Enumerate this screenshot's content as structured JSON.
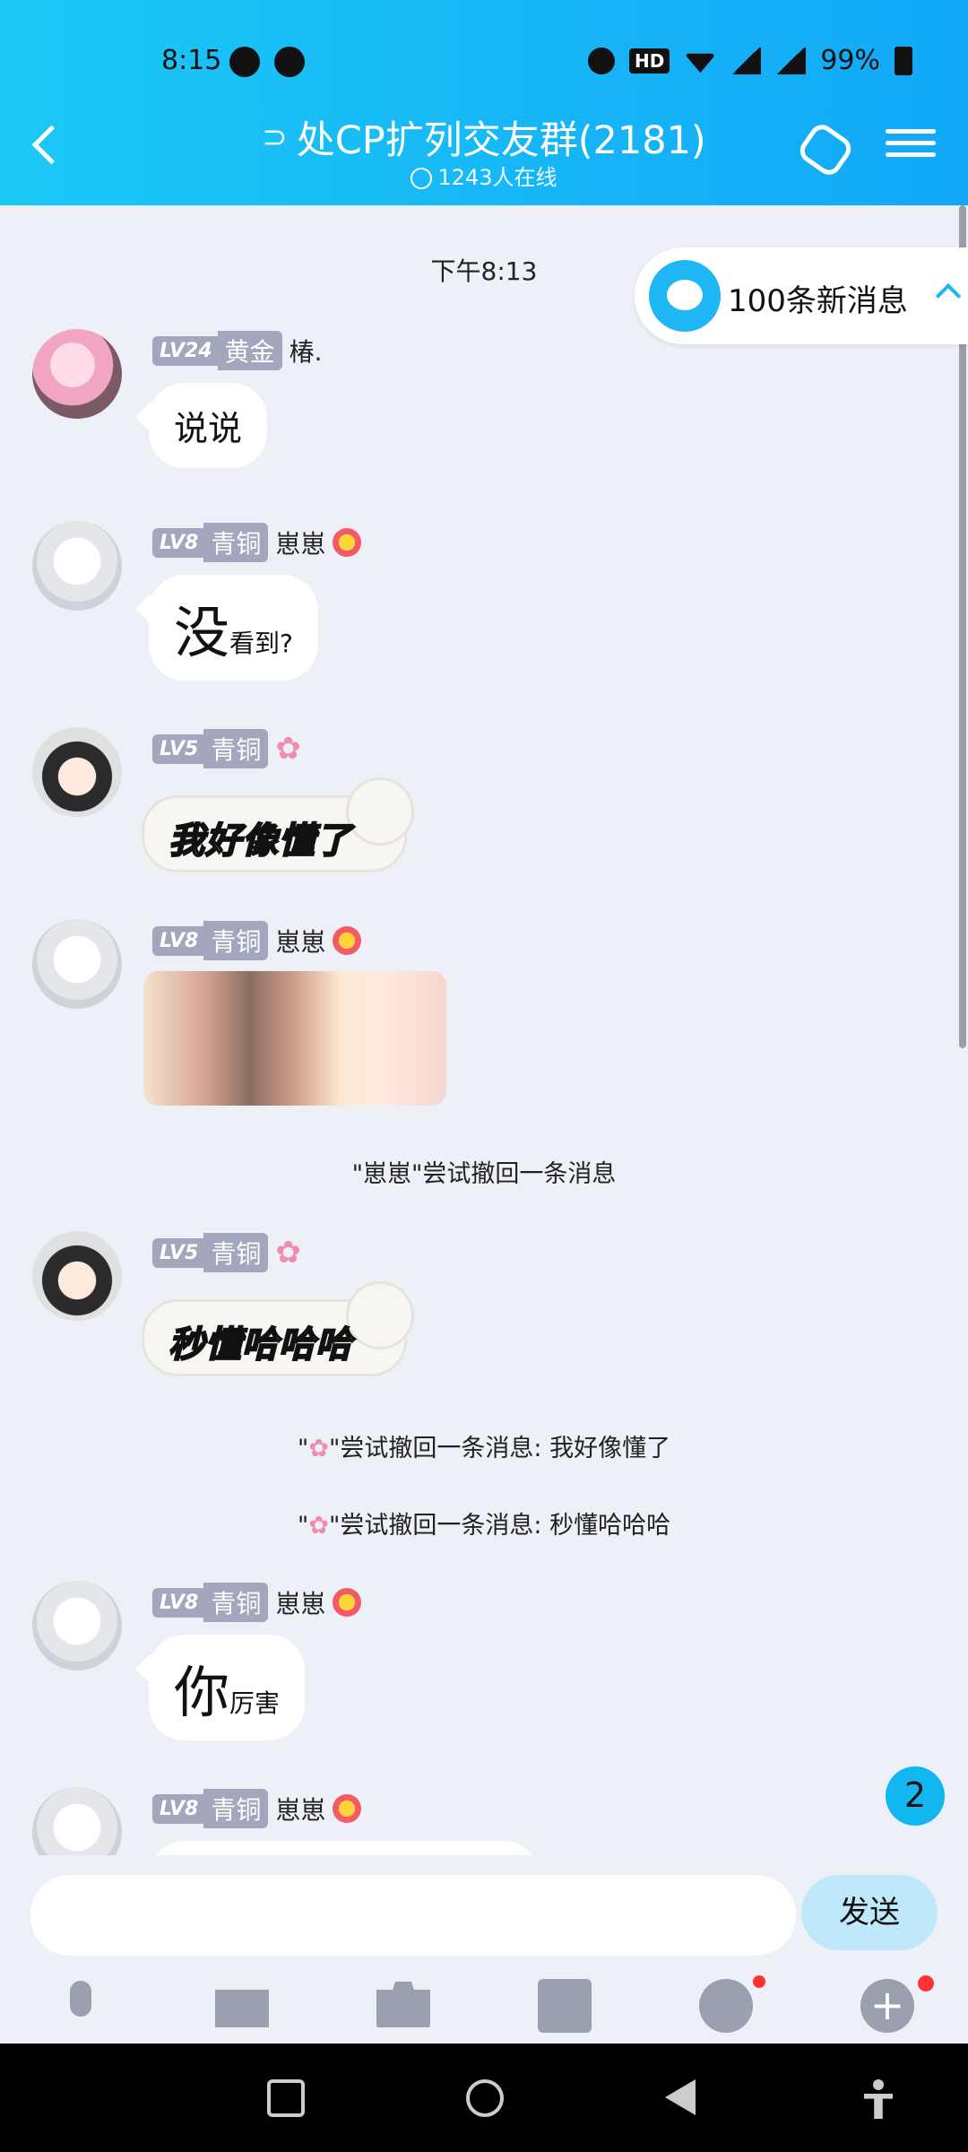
{
  "status_bar": {
    "time": "8:15",
    "hd": "HD",
    "net1": "4G",
    "net2": "4G",
    "battery": "99%"
  },
  "header": {
    "title": "处CP扩列交友群(2181)",
    "online": "1243人在线"
  },
  "notice": {
    "text": "100条新消息"
  },
  "chat": {
    "time_sep": "下午8:13",
    "messages": [
      {
        "level": "LV24",
        "rank": "黄金",
        "name": "椿.",
        "text": "说说"
      },
      {
        "level": "LV8",
        "rank": "青铜",
        "name": "崽崽",
        "big": "没",
        "small": "看到?"
      },
      {
        "level": "LV5",
        "rank": "青铜",
        "sticker": "我好像懂了"
      },
      {
        "level": "LV8",
        "rank": "青铜",
        "name": "崽崽"
      },
      {
        "level": "LV5",
        "rank": "青铜",
        "sticker": "秒懂哈哈哈"
      },
      {
        "level": "LV8",
        "rank": "青铜",
        "name": "崽崽",
        "big": "你",
        "small": "厉害"
      },
      {
        "level": "LV8",
        "rank": "青铜",
        "name": "崽崽"
      }
    ],
    "system": {
      "recall1": "\"崽崽\"尝试撤回一条消息",
      "recall2_pre": "\"",
      "recall2_post": "\"尝试撤回一条消息: 我好像懂了",
      "recall3_pre": "\"",
      "recall3_post": "\"尝试撤回一条消息: 秒懂哈哈哈"
    },
    "unread_count": "2"
  },
  "input": {
    "send_label": "发送",
    "placeholder": ""
  }
}
